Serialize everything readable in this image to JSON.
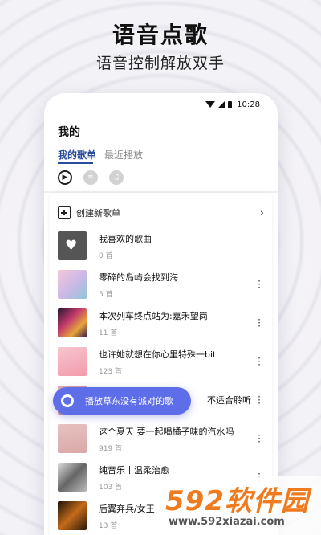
{
  "promo": {
    "headline": "语音点歌",
    "subline": "语音控制解放双手"
  },
  "statusbar": {
    "time": "10:28"
  },
  "page": {
    "title": "我的",
    "tabs": [
      {
        "label": "我的歌单",
        "active": true
      },
      {
        "label": "最近播放",
        "active": false
      }
    ],
    "platforms": [
      "youtube-icon",
      "spotify-icon",
      "apple-music-icon"
    ]
  },
  "create": {
    "label": "创建新歌单",
    "chevron": "›"
  },
  "playlists": [
    {
      "name": "我喜欢的歌曲",
      "count": "0 首"
    },
    {
      "name": "零碎的岛屿会找到海",
      "count": "5 首"
    },
    {
      "name": "本次列车终点站为:嘉禾望岗",
      "count": "11 首"
    },
    {
      "name": "也许她就想在你心里特殊一bit",
      "count": "123 首"
    },
    {
      "name": "不适合聆听",
      "count": ""
    },
    {
      "name": "这个夏天 要一起喝橘子味的汽水吗",
      "count": "919 首"
    },
    {
      "name": "纯音乐丨温柔治愈",
      "count": "103 首"
    },
    {
      "name": "后翼弃兵/女王",
      "count": "13 首"
    }
  ],
  "voice": {
    "text": "播放草东没有派对的歌"
  },
  "watermark": {
    "main": "592软件园",
    "sub": "www.592xiazai.com"
  },
  "colors": {
    "accent": "#2a4c9e",
    "voice": "#5e6ee8",
    "watermark": "#f07b1e"
  }
}
